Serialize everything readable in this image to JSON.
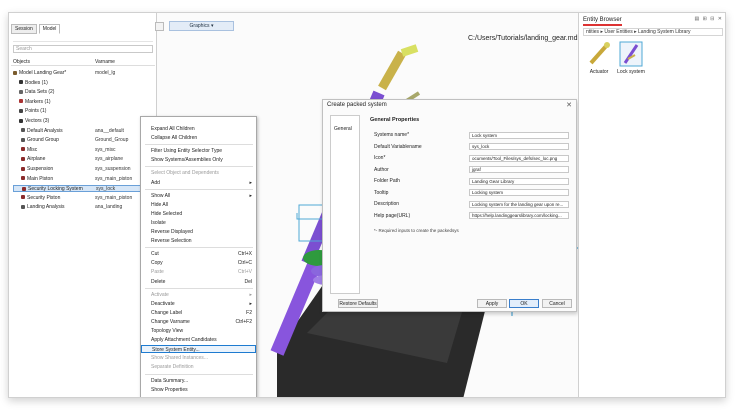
{
  "left_panel": {
    "tabs": [
      "Session",
      "Model"
    ],
    "search_placeholder": "Search",
    "columns": [
      "Objects",
      "Varname"
    ],
    "rows": [
      {
        "name": "Model Landing Gear*",
        "var": "model_lg",
        "color": "#7a5c2e"
      },
      {
        "name": "Bodies (1)",
        "var": "",
        "color": "#333333"
      },
      {
        "name": "Data Sets (2)",
        "var": "",
        "color": "#666666"
      },
      {
        "name": "Markers (1)",
        "var": "",
        "color": "#aa3333"
      },
      {
        "name": "Points (1)",
        "var": "",
        "color": "#444444"
      },
      {
        "name": "Vectors (3)",
        "var": "",
        "color": "#333333"
      },
      {
        "name": "Default Analysis",
        "var": "ana__default",
        "color": "#555555"
      },
      {
        "name": "Ground Group",
        "var": "Ground_Group",
        "color": "#555555"
      },
      {
        "name": "Misc",
        "var": "sys_misc",
        "color": "#8b2b2b"
      },
      {
        "name": "Airplane",
        "var": "sys_airplane",
        "color": "#8b2b2b"
      },
      {
        "name": "Suspension",
        "var": "sys_suspension",
        "color": "#8b2b2b"
      },
      {
        "name": "Main Piston",
        "var": "sys_main_piston",
        "color": "#8b2b2b"
      },
      {
        "name": "Security Locking System",
        "var": "sys_lock",
        "color": "#8b2b2b"
      },
      {
        "name": "Security Piston",
        "var": "sys_main_piston",
        "color": "#8b2b2b"
      },
      {
        "name": "Landing Analysis",
        "var": "ana_landing",
        "color": "#555555"
      }
    ]
  },
  "toolbar": {
    "graphics_label": "Graphics ▾",
    "file_path": "C:/Users/Tutorials/landing_gear.mdl"
  },
  "context_menu": {
    "items": [
      {
        "label": "Expand All Children",
        "shortcut": "",
        "disabled": false
      },
      {
        "label": "Collapse All Children",
        "shortcut": "",
        "disabled": false
      },
      {
        "label": "Filter Using Entity Selector Type",
        "shortcut": "",
        "disabled": false
      },
      {
        "label": "Show Systems/Assemblies Only",
        "shortcut": "",
        "disabled": false
      },
      {
        "label": "Select Object and Dependents",
        "shortcut": "",
        "disabled": true
      },
      {
        "label": "Add",
        "shortcut": "▸",
        "disabled": false
      },
      {
        "label": "Show All",
        "shortcut": "▸",
        "disabled": false
      },
      {
        "label": "Hide All",
        "shortcut": "",
        "disabled": false
      },
      {
        "label": "Hide Selected",
        "shortcut": "",
        "disabled": false
      },
      {
        "label": "Isolate",
        "shortcut": "",
        "disabled": false
      },
      {
        "label": "Reverse Displayed",
        "shortcut": "",
        "disabled": false
      },
      {
        "label": "Reverse Selection",
        "shortcut": "",
        "disabled": false
      },
      {
        "label": "Cut",
        "shortcut": "Ctrl+X",
        "disabled": false
      },
      {
        "label": "Copy",
        "shortcut": "Ctrl+C",
        "disabled": false
      },
      {
        "label": "Paste",
        "shortcut": "Ctrl+V",
        "disabled": true
      },
      {
        "label": "Delete",
        "shortcut": "Del",
        "disabled": false
      },
      {
        "label": "Activate",
        "shortcut": "▸",
        "disabled": true
      },
      {
        "label": "Deactivate",
        "shortcut": "▸",
        "disabled": false
      },
      {
        "label": "Change Label",
        "shortcut": "F2",
        "disabled": false
      },
      {
        "label": "Change Varname",
        "shortcut": "Ctrl+F2",
        "disabled": false
      },
      {
        "label": "Topology View",
        "shortcut": "",
        "disabled": false
      },
      {
        "label": "Apply Attachment Candidates",
        "shortcut": "",
        "disabled": false
      },
      {
        "label": "Store System Entity...",
        "shortcut": "",
        "disabled": false
      },
      {
        "label": "Show Shared Instances...",
        "shortcut": "",
        "disabled": true
      },
      {
        "label": "Separate Definition",
        "shortcut": "",
        "disabled": true
      },
      {
        "label": "Data Summary...",
        "shortcut": "",
        "disabled": false
      },
      {
        "label": "Show Properties",
        "shortcut": "",
        "disabled": false
      }
    ]
  },
  "dialog": {
    "title": "Create packed system",
    "nav_item": "General",
    "section": "General Properties",
    "fields": [
      {
        "label": "Systems name*",
        "value": "Lock system"
      },
      {
        "label": "Default Variablename",
        "value": "sys_lock"
      },
      {
        "label": "Icon*",
        "value": "ocuments/Tool_Files/sys_defs/sec_loc.png"
      },
      {
        "label": "Author",
        "value": "jgraf"
      },
      {
        "label": "Folder Path",
        "value": "Landing Gear Library"
      },
      {
        "label": "Tooltip",
        "value": "Locking system"
      },
      {
        "label": "Description",
        "value": "Locking system for the landing gear upon re..."
      },
      {
        "label": "Help page(URL)",
        "value": "https://help.landinggearslibrary.com/locking..."
      }
    ],
    "note": "*- Required inputs to create the packedsys",
    "buttons": {
      "restore": "Restore Defaults",
      "apply": "Apply",
      "ok": "OK",
      "cancel": "Cancel"
    }
  },
  "entity_browser": {
    "title": "Entity Browser",
    "path": "ntities ▸ User Entities ▸ Landing System Library",
    "items": [
      {
        "label": "Actuator"
      },
      {
        "label": "Lock system"
      }
    ]
  }
}
